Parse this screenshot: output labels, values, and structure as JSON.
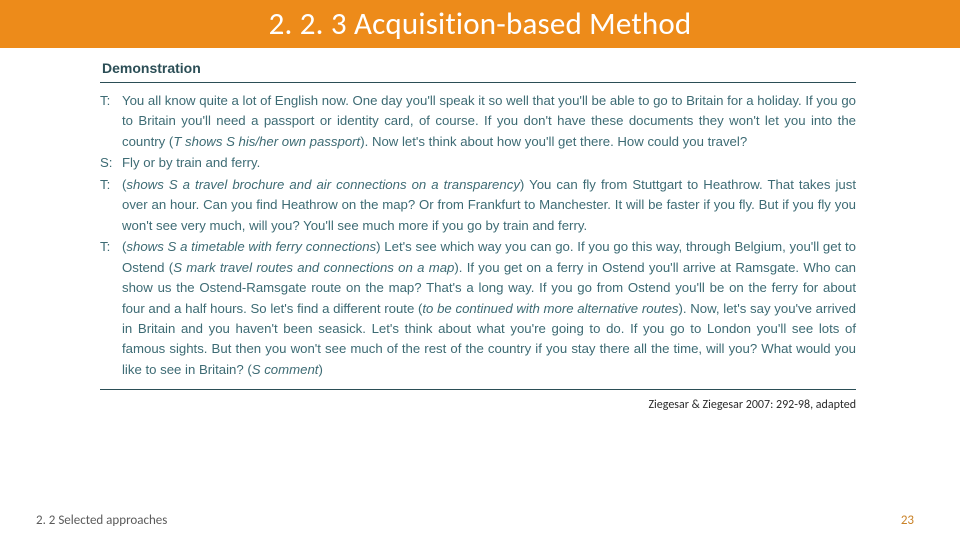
{
  "title": "2. 2. 3 Acquisition-based Method",
  "demo": {
    "header": "Demonstration",
    "turns": [
      {
        "speaker": "T:",
        "plain": "You all know quite a lot of English now. One day you'll speak it so well that you'll be able to go to Britain for a holiday. If you go to Britain you'll need a passport or identity card, of course. If you don't have these documents they won't let you into the country (",
        "italic1": "T shows S his/her own passport",
        "plain2": "). Now let's think about how you'll get there. How could you travel?"
      },
      {
        "speaker": "S:",
        "plain": "Fly or by train and ferry."
      },
      {
        "speaker": "T:",
        "plain": "(",
        "italic1": "shows S a travel brochure and air connections on a transparency",
        "plain2": ") You can fly from Stuttgart to Heathrow. That takes just over an hour. Can you find Heathrow on the map? Or from Frankfurt to Manchester. It will be faster if you fly. But if you fly you won't see very much, will you? You'll see much more if you go by train and ferry."
      },
      {
        "speaker": "T:",
        "plain": "(",
        "italic1": "shows S a timetable with ferry connections",
        "plain2": ") Let's see which way you can go. If you go this way, through Belgium, you'll get to Ostend (",
        "italic2": "S mark travel routes and connections on a map",
        "plain3": "). If you get on a ferry in Ostend you'll arrive at Ramsgate. Who can show us the Ostend-Ramsgate route on the map? That's a long way. If you go from Ostend you'll be on the ferry for about four and a half hours. So let's find a different route (",
        "italic3": "to be continued with more alternative routes",
        "plain4": "). Now, let's say you've arrived in Britain and you haven't been seasick. Let's think about what you're going to do. If you go to London you'll see lots of famous sights. But then you won't see much of the rest of the country if you stay there all the time, will you? What would you like to see in Britain? (",
        "italic4": "S comment",
        "plain5": ")"
      }
    ]
  },
  "citation": "Ziegesar & Ziegesar 2007: 292-98, adapted",
  "footer": {
    "section": "2. 2 Selected approaches",
    "page": "23"
  }
}
